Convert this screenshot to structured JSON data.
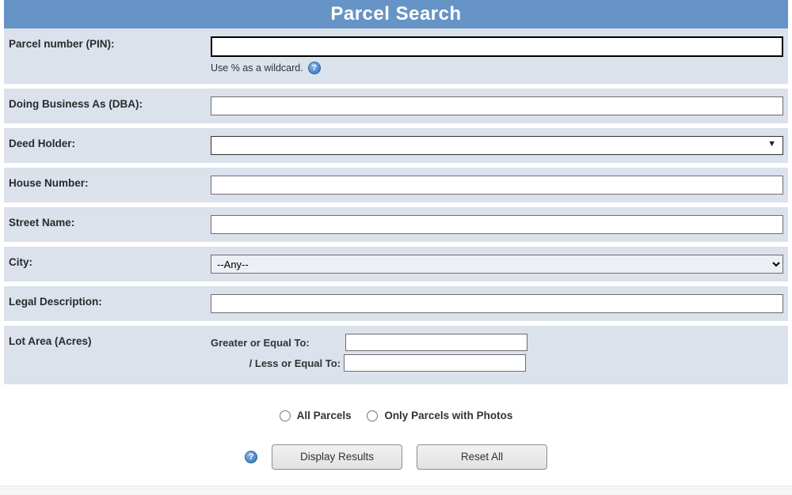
{
  "header": {
    "title": "Parcel Search"
  },
  "fields": {
    "pin": {
      "label": "Parcel number (PIN):",
      "value": "",
      "hint": "Use % as a wildcard."
    },
    "dba": {
      "label": "Doing Business As (DBA):",
      "value": ""
    },
    "deed": {
      "label": "Deed Holder:",
      "value": ""
    },
    "house": {
      "label": "House Number:",
      "value": ""
    },
    "street": {
      "label": "Street Name:",
      "value": ""
    },
    "city": {
      "label": "City:",
      "selected": "--Any--"
    },
    "legal": {
      "label": "Legal Description:",
      "value": ""
    },
    "lot": {
      "label": "Lot Area (Acres)",
      "gte_label": "Greater or Equal To:",
      "lte_label": "/ Less or Equal To:",
      "gte_value": "",
      "lte_value": ""
    }
  },
  "radios": {
    "all": "All Parcels",
    "photos": "Only Parcels with Photos"
  },
  "buttons": {
    "display": "Display Results",
    "reset": "Reset All"
  }
}
